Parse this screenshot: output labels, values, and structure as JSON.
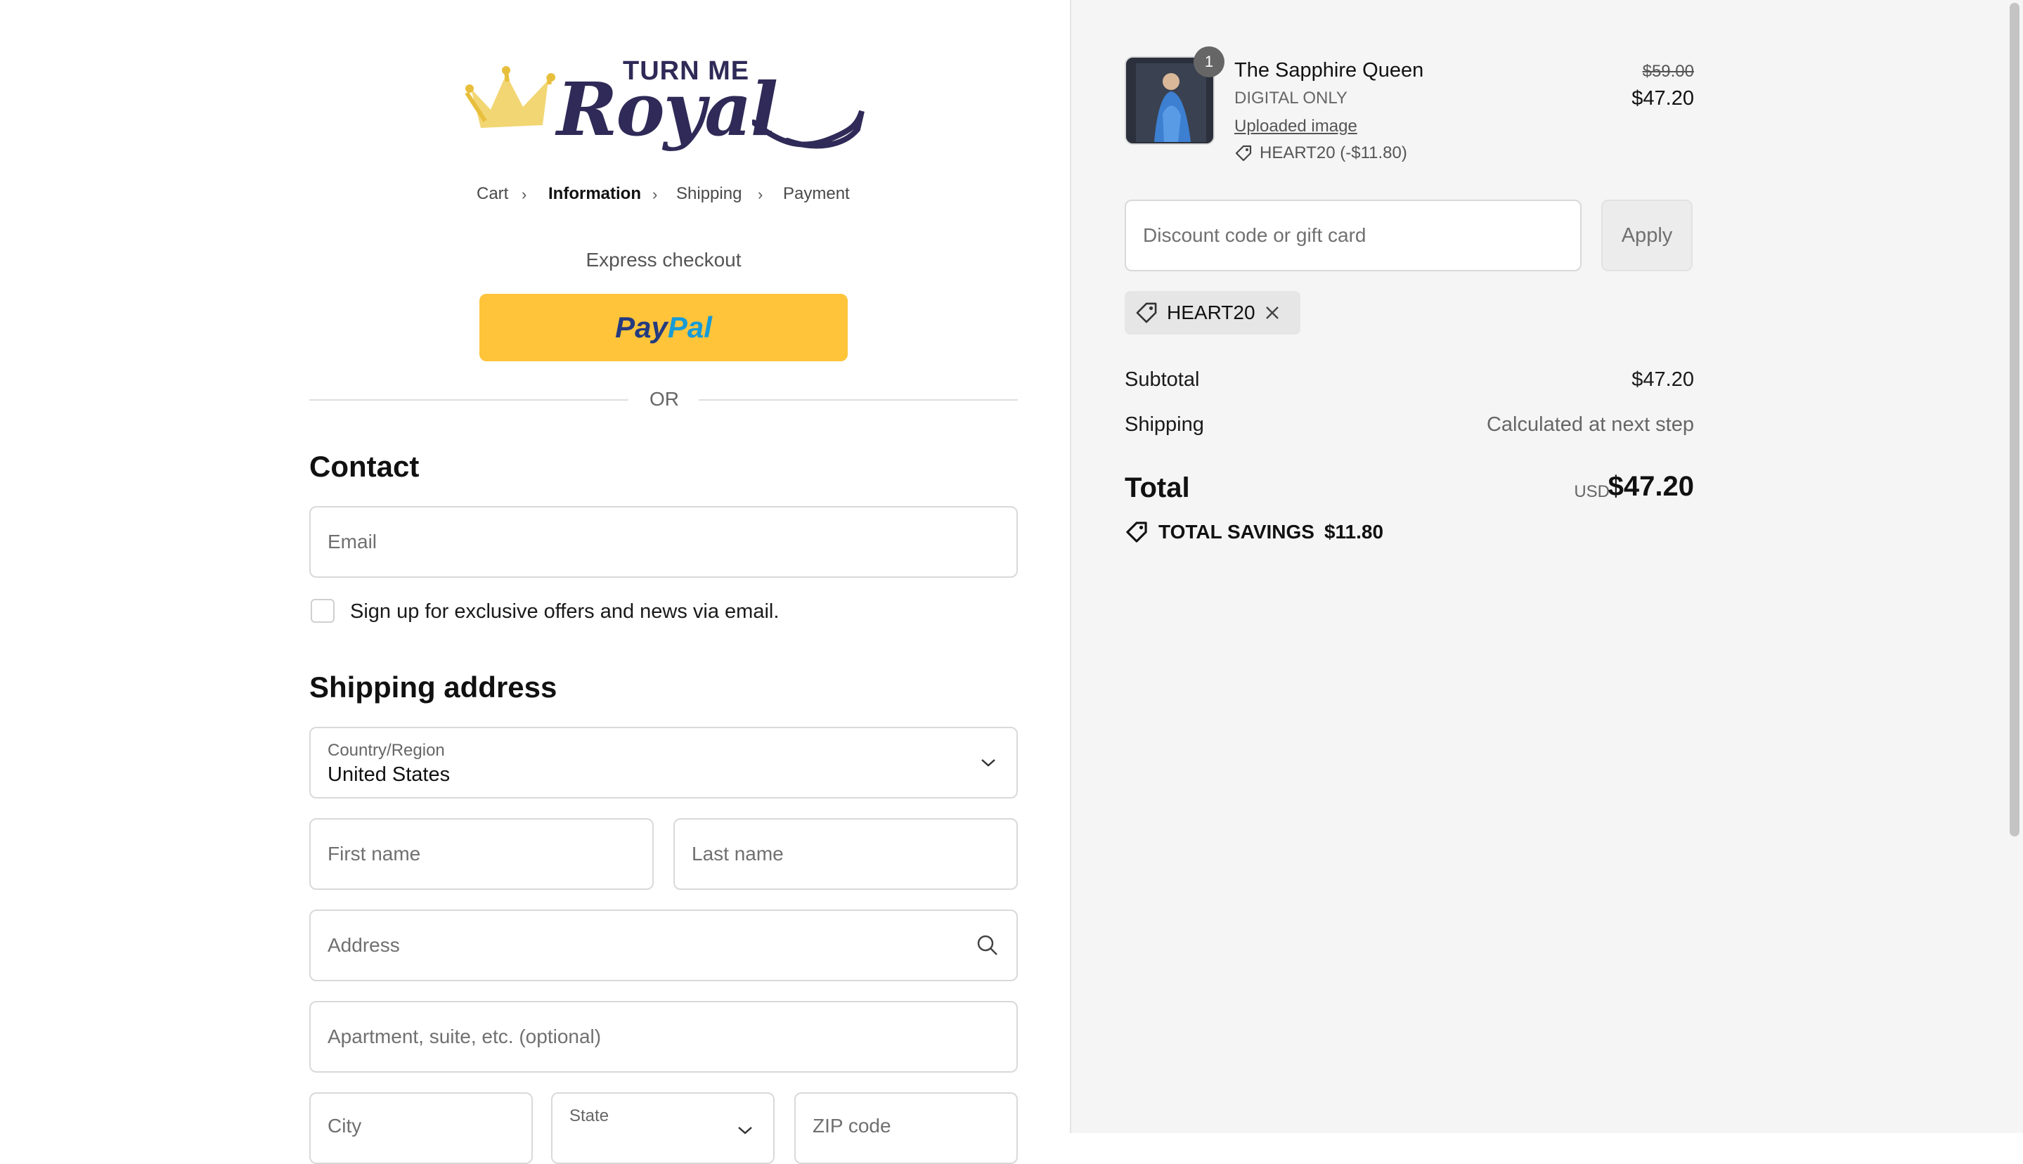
{
  "brand": {
    "logo_top": "TURN ME",
    "logo_main": "Royal"
  },
  "breadcrumb": {
    "items": [
      "Cart",
      "Information",
      "Shipping",
      "Payment"
    ],
    "active_index": 1
  },
  "express": {
    "label": "Express checkout",
    "paypal_pay": "Pay",
    "paypal_pal": "Pal",
    "or_label": "OR"
  },
  "contact": {
    "title": "Contact",
    "email_placeholder": "Email",
    "newsletter_label": "Sign up for exclusive offers and news via email.",
    "newsletter_checked": false
  },
  "shipping": {
    "title": "Shipping address",
    "country_label": "Country/Region",
    "country_value": "United States",
    "first_name_placeholder": "First name",
    "last_name_placeholder": "Last name",
    "address_placeholder": "Address",
    "apartment_placeholder": "Apartment, suite, etc. (optional)",
    "city_placeholder": "City",
    "state_label": "State",
    "zip_placeholder": "ZIP code"
  },
  "order": {
    "item": {
      "quantity": "1",
      "name": "The Sapphire Queen",
      "variant": "DIGITAL ONLY",
      "link_label": "Uploaded image",
      "discount_line": "HEART20 (-$11.80)",
      "original_price": "$59.00",
      "price": "$47.20"
    },
    "discount_placeholder": "Discount code or gift card",
    "apply_label": "Apply",
    "applied_code": "HEART20",
    "subtotal_label": "Subtotal",
    "subtotal_value": "$47.20",
    "shipping_label": "Shipping",
    "shipping_value": "Calculated at next step",
    "total_label": "Total",
    "currency": "USD",
    "total_value": "$47.20",
    "savings_label": "TOTAL SAVINGS",
    "savings_value": "$11.80"
  },
  "colors": {
    "paypal_yellow": "#ffc43a",
    "brand_navy": "#2f2a57",
    "crown_gold": "#f0cf5a"
  }
}
